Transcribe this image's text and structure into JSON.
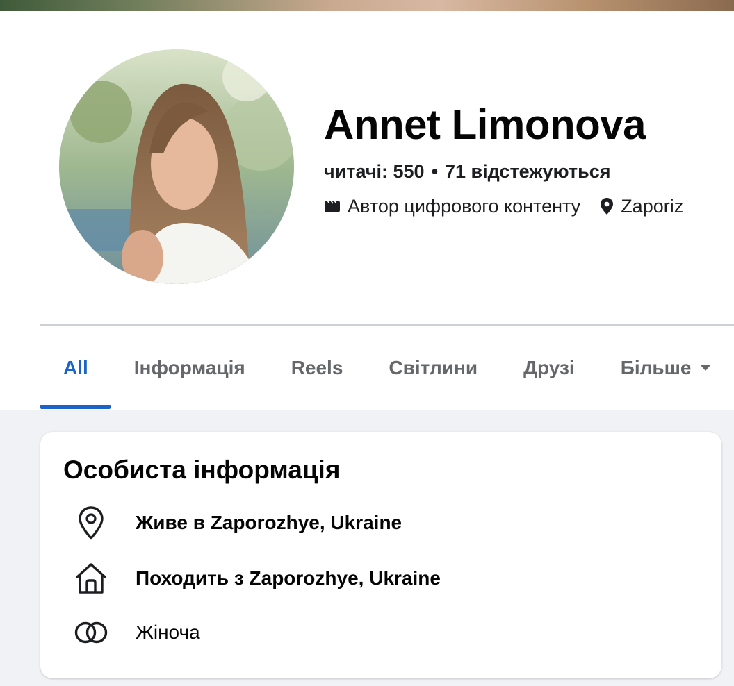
{
  "profile": {
    "name": "Annet Limonova",
    "followers": "читачі: 550",
    "following": "71 відстежуються",
    "category": "Автор цифрового контенту",
    "location_short": "Zaporiz"
  },
  "tabs": [
    {
      "label": "All",
      "active": true
    },
    {
      "label": "Інформація"
    },
    {
      "label": "Reels"
    },
    {
      "label": "Світлини"
    },
    {
      "label": "Друзі"
    },
    {
      "label": "Більше"
    }
  ],
  "personal_info": {
    "title": "Особиста інформація",
    "items": [
      {
        "icon": "location-pin-icon",
        "text": "Живе в Zaporozhye, Ukraine"
      },
      {
        "icon": "home-icon",
        "text": "Походить з Zaporozhye, Ukraine"
      },
      {
        "icon": "gender-icon",
        "text": "Жіноча"
      }
    ]
  },
  "colors": {
    "accent": "#1b63c9",
    "page_bg": "#f0f2f5",
    "secondary_text": "#65676b"
  }
}
